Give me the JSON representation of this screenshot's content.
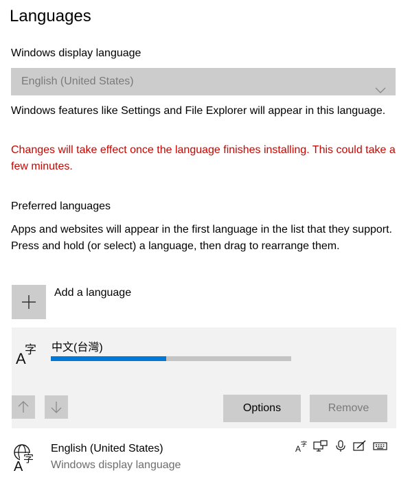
{
  "page": {
    "title": "Languages"
  },
  "display_language": {
    "label": "Windows display language",
    "selected": "English (United States)",
    "description": "Windows features like Settings and File Explorer will appear in this language.",
    "warning": "Changes will take effect once the language finishes installing. This could take a few minutes."
  },
  "preferred": {
    "label": "Preferred languages",
    "description": "Apps and websites will appear in the first language in the list that they support. Press and hold (or select) a language, then drag to rearrange them.",
    "add_label": "Add a language",
    "items": [
      {
        "name": "中文(台灣)",
        "icon": "language-glyph-icon",
        "install_progress_pct": 48,
        "buttons": {
          "options": "Options",
          "remove": "Remove"
        }
      },
      {
        "name": "English (United States)",
        "subtitle": "Windows display language",
        "icon": "display-language-icon",
        "features": [
          "language-pack-icon",
          "text-to-speech-icon",
          "speech-recognition-icon",
          "handwriting-icon",
          "keyboard-icon"
        ]
      }
    ]
  },
  "colors": {
    "accent": "#0078d7",
    "warning": "#c50500",
    "button_bg": "#cccccc",
    "panel_bg": "#f2f2f2"
  }
}
